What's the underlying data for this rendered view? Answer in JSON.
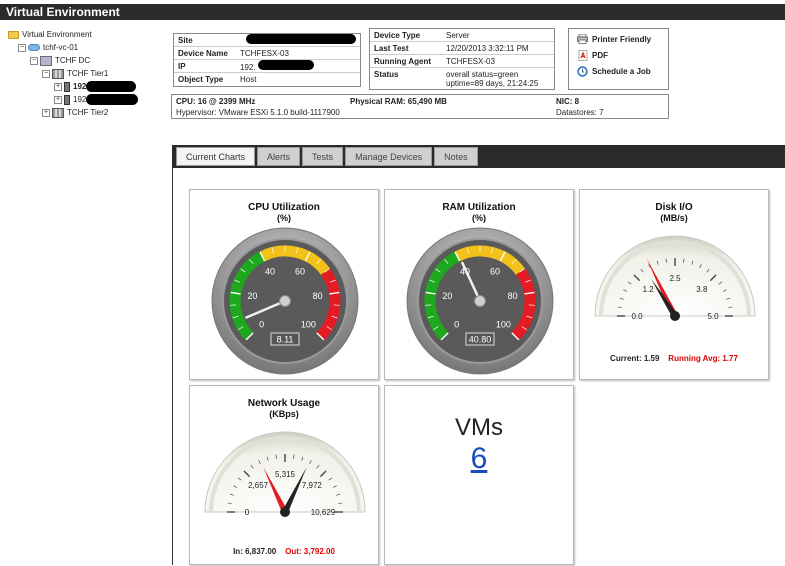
{
  "header": {
    "title": "Virtual Environment"
  },
  "tree": {
    "root": "Virtual Environment",
    "vc": "tchf-vc-01",
    "dc": "TCHF DC",
    "tier1": "TCHF Tier1",
    "host1": "192",
    "host2": "192",
    "tier2": "TCHF Tier2"
  },
  "device": {
    "site_label": "Site",
    "site_value": "",
    "name_label": "Device Name",
    "name_value": "TCHFESX-03",
    "ip_label": "IP",
    "ip_value": "192.",
    "type_label": "Object Type",
    "type_value": "Host"
  },
  "status_box": {
    "device_type_label": "Device Type",
    "device_type_value": "Server",
    "last_test_label": "Last Test",
    "last_test_value": "12/20/2013 3:32:11 PM",
    "agent_label": "Running Agent",
    "agent_value": "TCHFESX-03",
    "status_label": "Status",
    "status_line1": "overall status=green",
    "status_line2": "uptime=89 days, 21:24:25"
  },
  "actions": {
    "printer": "Printer Friendly",
    "pdf": "PDF",
    "schedule": "Schedule a Job"
  },
  "specs": {
    "cpu": "CPU: 16 @ 2399 MHz",
    "ram": "Physical RAM: 65,490 MB",
    "nic": "NIC: 8",
    "hypervisor": "Hypervisor: VMware ESXi 5.1.0 build-1117900",
    "datastores": "Datastores: 7"
  },
  "tabs": [
    {
      "label": "Current Charts"
    },
    {
      "label": "Alerts"
    },
    {
      "label": "Tests"
    },
    {
      "label": "Manage Devices"
    },
    {
      "label": "Notes"
    }
  ],
  "cpu_gauge": {
    "title": "CPU Utilization",
    "unit": "(%)",
    "value": 8.11,
    "value_text": "8.11",
    "min": 0,
    "max": 100,
    "ticks": [
      "0",
      "20",
      "40",
      "60",
      "80",
      "100"
    ]
  },
  "ram_gauge": {
    "title": "RAM Utilization",
    "unit": "(%)",
    "value": 40.8,
    "value_text": "40.80",
    "min": 0,
    "max": 100,
    "ticks": [
      "0",
      "20",
      "40",
      "60",
      "80",
      "100"
    ]
  },
  "disk_gauge": {
    "title": "Disk I/O",
    "unit": "(MB/s)",
    "min": 0,
    "max": 5,
    "ticks": [
      "0.0",
      "1.2",
      "2.5",
      "3.8",
      "5.0"
    ],
    "current_value": 1.59,
    "avg_value": 1.77,
    "current_text": "Current: 1.59",
    "avg_text": "Running Avg: 1.77"
  },
  "network_gauge": {
    "title": "Network Usage",
    "unit": "(KBps)",
    "min": 0,
    "max": 10629,
    "ticks": [
      "0",
      "2,657",
      "5,315",
      "7,972",
      "10,629"
    ],
    "in_value": 6837,
    "out_value": 3792,
    "in_text": "In: 6,837.00",
    "out_text": "Out: 3,792.00"
  },
  "vms": {
    "label": "VMs",
    "count": "6"
  },
  "colors": {
    "green": "#1ea81e",
    "yellow": "#f2c21a",
    "red": "#e31b23",
    "accent": "#1a4dbb"
  }
}
